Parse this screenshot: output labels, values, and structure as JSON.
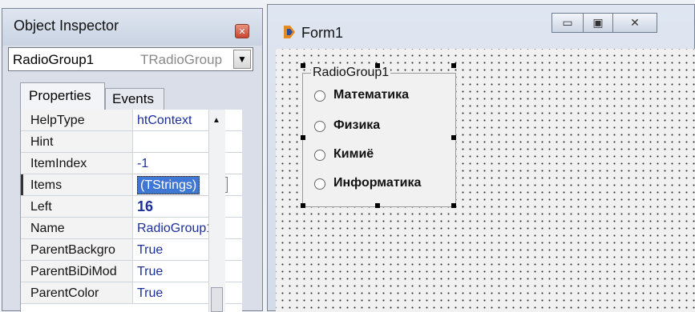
{
  "object_inspector": {
    "title": "Object Inspector",
    "close_icon": "close-icon",
    "component_name": "RadioGroup1",
    "component_type": "TRadioGroup",
    "tabs": [
      "Properties",
      "Events"
    ],
    "active_tab": "Properties",
    "properties": [
      {
        "name": "HelpType",
        "value": "htContext"
      },
      {
        "name": "Hint",
        "value": ""
      },
      {
        "name": "ItemIndex",
        "value": "-1"
      },
      {
        "name": "Items",
        "value": "(TStrings)"
      },
      {
        "name": "Left",
        "value": "16"
      },
      {
        "name": "Name",
        "value": "RadioGroup1"
      },
      {
        "name": "ParentBackgro",
        "value": "True"
      },
      {
        "name": "ParentBiDiMod",
        "value": "True"
      },
      {
        "name": "ParentColor",
        "value": "True"
      }
    ],
    "ellipsis": "..."
  },
  "form": {
    "title": "Form1",
    "radio_group": {
      "caption": "RadioGroup1",
      "items": [
        "Математика",
        "Физика",
        "Кимиё",
        "Информатика"
      ]
    }
  },
  "colors": {
    "value_text": "#1c2f9a",
    "selection": "#3f78d4"
  }
}
